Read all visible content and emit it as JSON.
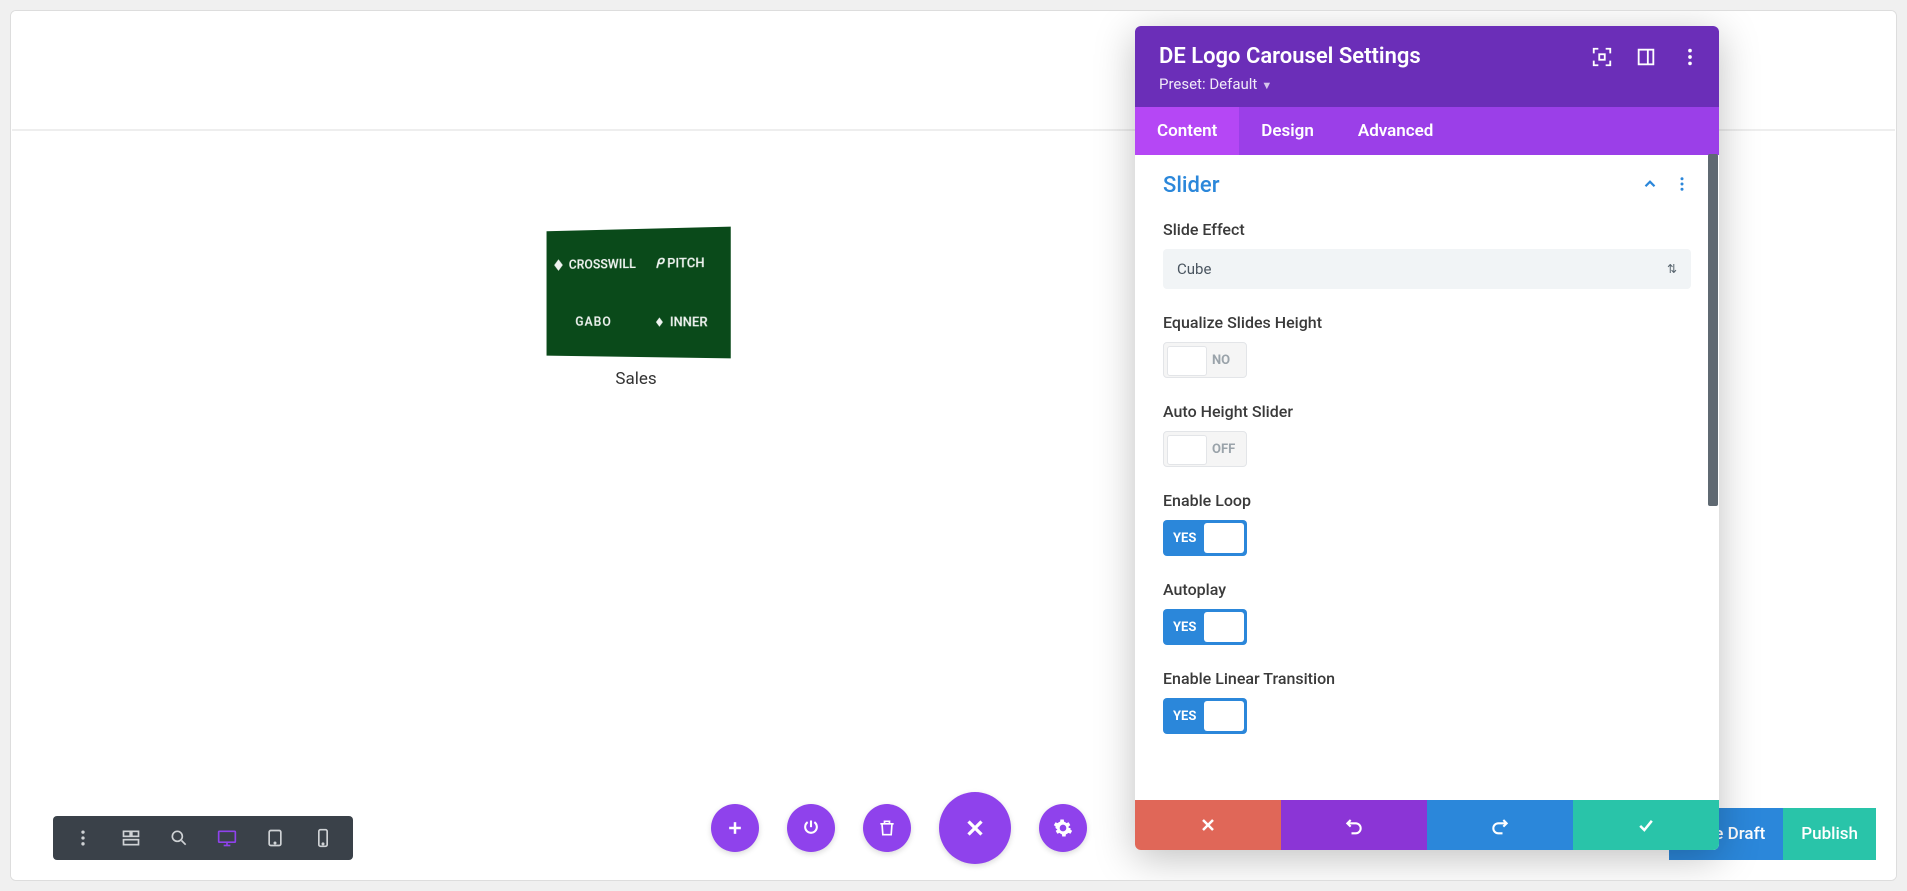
{
  "canvas": {
    "logo_caption": "Sales",
    "logos": [
      "CROSSWILL",
      "PITCH",
      "GABO",
      "INNER"
    ]
  },
  "bottom_toolbar": {
    "items": [
      "menu",
      "wireframe",
      "zoom",
      "desktop",
      "tablet",
      "phone"
    ],
    "active": "desktop"
  },
  "circle_buttons": [
    "add",
    "power",
    "trash",
    "close",
    "gear"
  ],
  "builder": {
    "save_draft": "Save Draft",
    "publish": "Publish"
  },
  "modal": {
    "title": "DE Logo Carousel Settings",
    "preset_label": "Preset: Default",
    "tabs": [
      "Content",
      "Design",
      "Advanced"
    ],
    "active_tab": "Content",
    "section": "Slider",
    "fields": {
      "slide_effect": {
        "label": "Slide Effect",
        "value": "Cube"
      },
      "equalize": {
        "label": "Equalize Slides Height",
        "value": "NO",
        "on": false
      },
      "auto_height": {
        "label": "Auto Height Slider",
        "value": "OFF",
        "on": false
      },
      "enable_loop": {
        "label": "Enable Loop",
        "value": "YES",
        "on": true
      },
      "autoplay": {
        "label": "Autoplay",
        "value": "YES",
        "on": true
      },
      "linear": {
        "label": "Enable Linear Transition",
        "value": "YES",
        "on": true
      }
    }
  }
}
